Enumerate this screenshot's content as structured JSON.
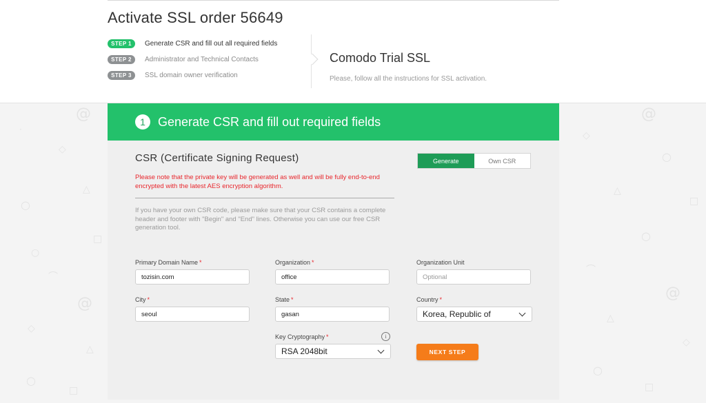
{
  "page": {
    "title": "Activate SSL order 56649"
  },
  "steps": [
    {
      "badge": "STEP 1",
      "label": "Generate CSR and fill out all required fields"
    },
    {
      "badge": "STEP 2",
      "label": "Administrator and Technical Contacts"
    },
    {
      "badge": "STEP 3",
      "label": "SSL domain owner verification"
    }
  ],
  "product": {
    "name": "Comodo Trial SSL",
    "subtitle": "Please, follow all the instructions for SSL activation."
  },
  "section": {
    "number": "1",
    "title": "Generate CSR and fill out required fields"
  },
  "csr": {
    "title": "CSR (Certificate Signing Request)",
    "warning": "Please note that the private key will be generated as well and will be fully end-to-end encrypted with the latest AES encryption algorithm.",
    "info": "If you have your own CSR code, please make sure that your CSR contains a complete header and footer with \"Begin\" and \"End\" lines. Otherwise you can use our free CSR generation tool.",
    "toggle": {
      "generate": "Generate",
      "own": "Own CSR"
    }
  },
  "form": {
    "required_mark": "*",
    "primary_domain": {
      "label": "Primary Domain Name",
      "value": "tozisin.com"
    },
    "organization": {
      "label": "Organization",
      "value": "office"
    },
    "organization_unit": {
      "label": "Organization Unit",
      "placeholder": "Optional"
    },
    "city": {
      "label": "City",
      "value": "seoul"
    },
    "state": {
      "label": "State",
      "value": "gasan"
    },
    "country": {
      "label": "Country",
      "value": "Korea, Republic of"
    },
    "key_crypto": {
      "label": "Key Cryptography",
      "value": "RSA 2048bit",
      "info_icon": "i"
    }
  },
  "next_button": {
    "label": "NEXT STEP"
  },
  "colors": {
    "accent": "#23c16b",
    "warning": "#e8262c",
    "next": "#f57c1a",
    "badge_inactive": "#8e9193"
  }
}
